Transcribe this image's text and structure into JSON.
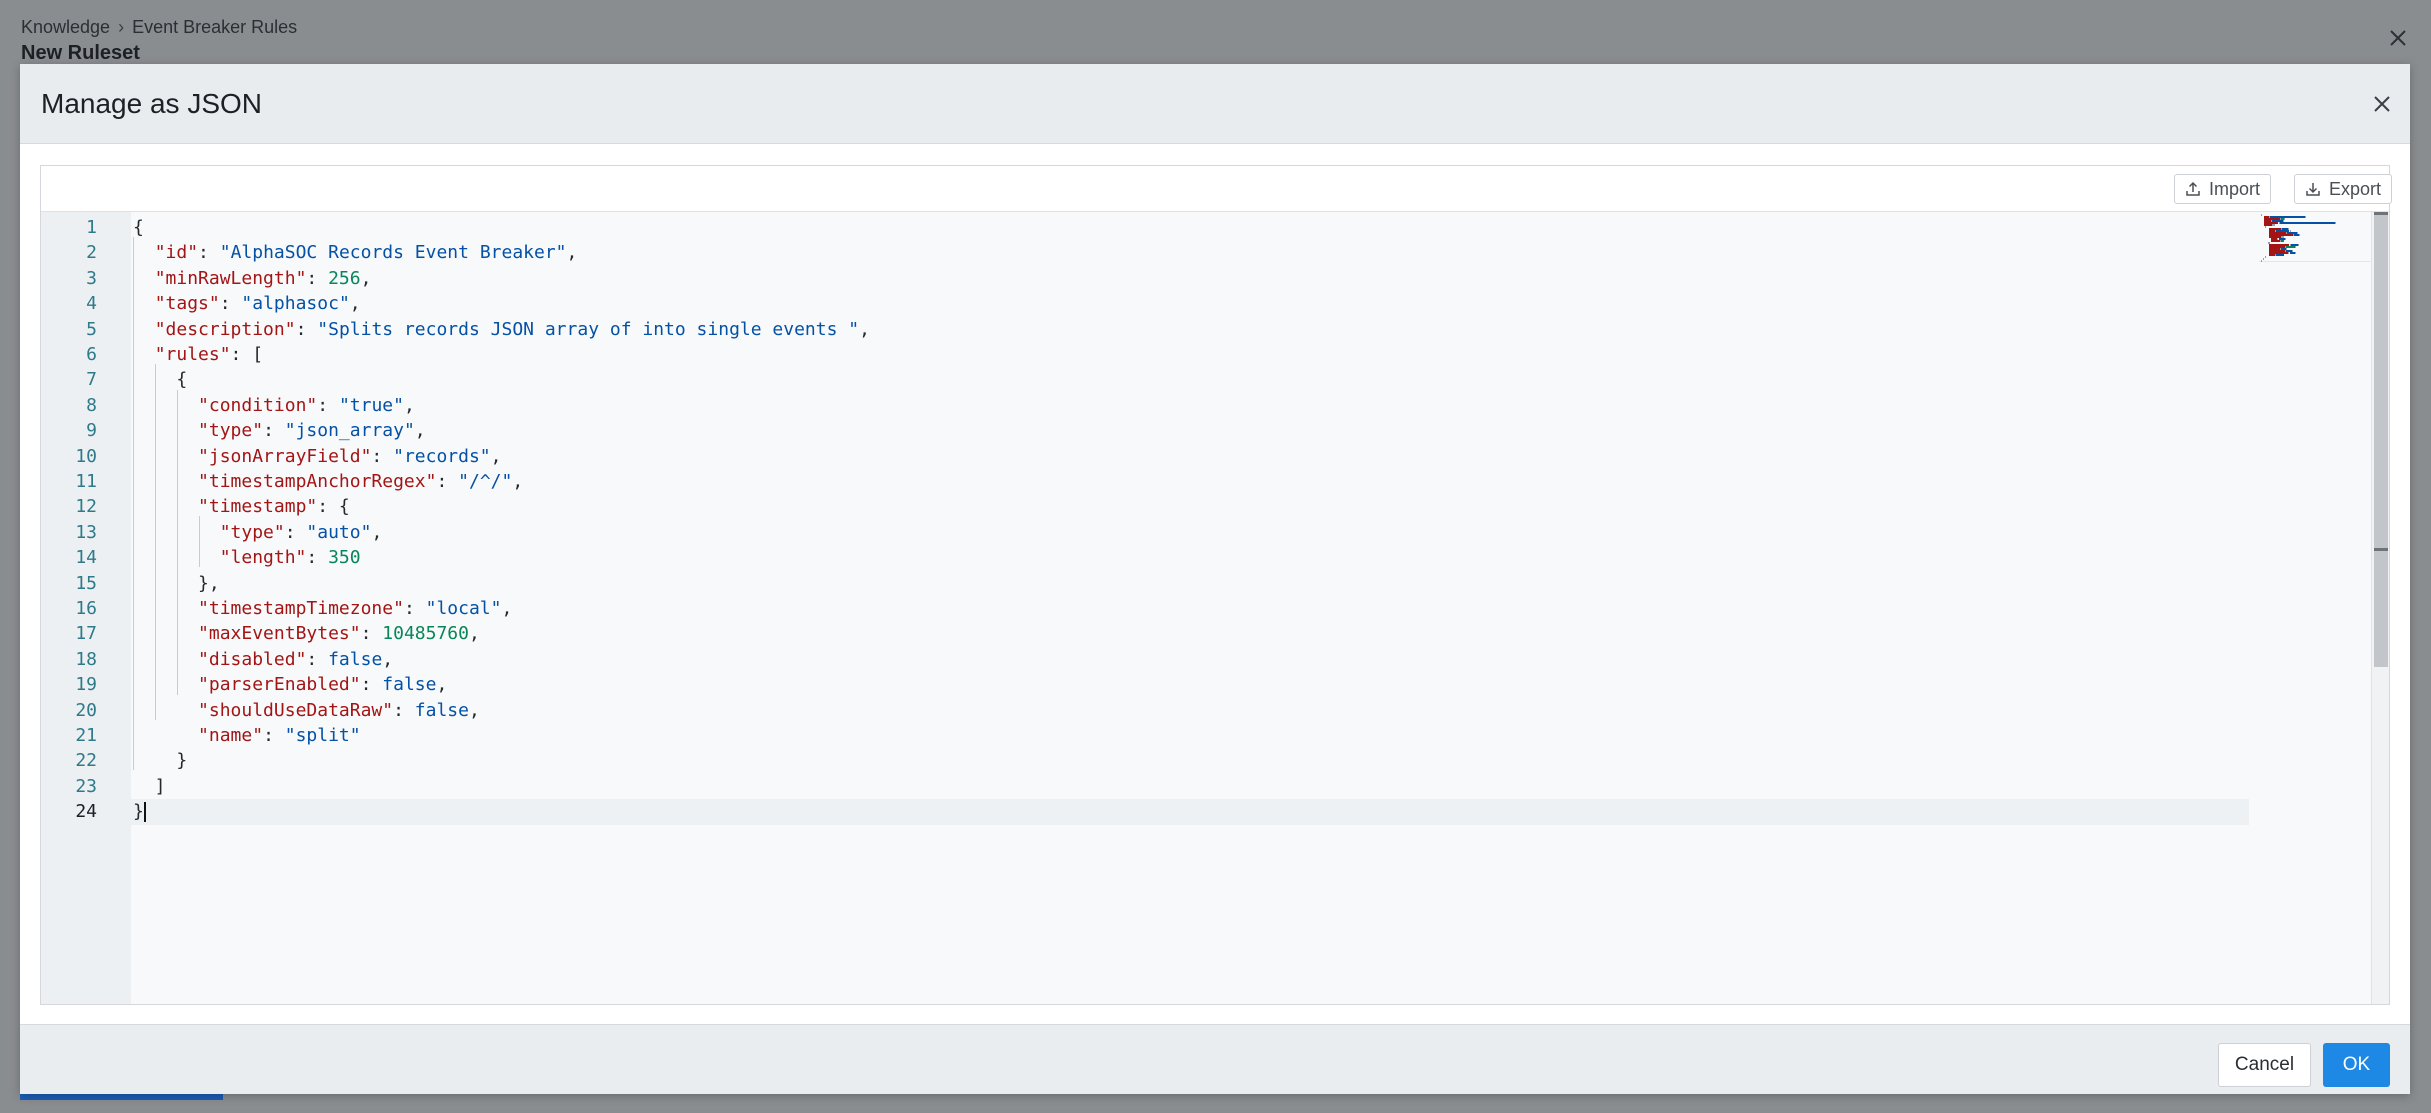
{
  "background": {
    "breadcrumb": [
      "Knowledge",
      "Event Breaker Rules"
    ],
    "breadcrumb_separator": "›",
    "title": "New Ruleset"
  },
  "modal": {
    "title": "Manage as JSON",
    "toolbar": {
      "import_label": "Import",
      "export_label": "Export"
    },
    "footer": {
      "cancel_label": "Cancel",
      "ok_label": "OK"
    }
  },
  "editor": {
    "active_line": 24,
    "lines": [
      [
        [
          "p",
          "{"
        ]
      ],
      [
        [
          "p",
          "  "
        ],
        [
          "k",
          "\"id\""
        ],
        [
          "p",
          ": "
        ],
        [
          "s",
          "\"AlphaSOC Records Event Breaker\""
        ],
        [
          "p",
          ","
        ]
      ],
      [
        [
          "p",
          "  "
        ],
        [
          "k",
          "\"minRawLength\""
        ],
        [
          "p",
          ": "
        ],
        [
          "n",
          "256"
        ],
        [
          "p",
          ","
        ]
      ],
      [
        [
          "p",
          "  "
        ],
        [
          "k",
          "\"tags\""
        ],
        [
          "p",
          ": "
        ],
        [
          "s",
          "\"alphasoc\""
        ],
        [
          "p",
          ","
        ]
      ],
      [
        [
          "p",
          "  "
        ],
        [
          "k",
          "\"description\""
        ],
        [
          "p",
          ": "
        ],
        [
          "s",
          "\"Splits records JSON array of into single events \""
        ],
        [
          "p",
          ","
        ]
      ],
      [
        [
          "p",
          "  "
        ],
        [
          "k",
          "\"rules\""
        ],
        [
          "p",
          ": ["
        ]
      ],
      [
        [
          "p",
          "    {"
        ]
      ],
      [
        [
          "p",
          "      "
        ],
        [
          "k",
          "\"condition\""
        ],
        [
          "p",
          ": "
        ],
        [
          "s",
          "\"true\""
        ],
        [
          "p",
          ","
        ]
      ],
      [
        [
          "p",
          "      "
        ],
        [
          "k",
          "\"type\""
        ],
        [
          "p",
          ": "
        ],
        [
          "s",
          "\"json_array\""
        ],
        [
          "p",
          ","
        ]
      ],
      [
        [
          "p",
          "      "
        ],
        [
          "k",
          "\"jsonArrayField\""
        ],
        [
          "p",
          ": "
        ],
        [
          "s",
          "\"records\""
        ],
        [
          "p",
          ","
        ]
      ],
      [
        [
          "p",
          "      "
        ],
        [
          "k",
          "\"timestampAnchorRegex\""
        ],
        [
          "p",
          ": "
        ],
        [
          "s",
          "\"/^/\""
        ],
        [
          "p",
          ","
        ]
      ],
      [
        [
          "p",
          "      "
        ],
        [
          "k",
          "\"timestamp\""
        ],
        [
          "p",
          ": {"
        ]
      ],
      [
        [
          "p",
          "        "
        ],
        [
          "k",
          "\"type\""
        ],
        [
          "p",
          ": "
        ],
        [
          "s",
          "\"auto\""
        ],
        [
          "p",
          ","
        ]
      ],
      [
        [
          "p",
          "        "
        ],
        [
          "k",
          "\"length\""
        ],
        [
          "p",
          ": "
        ],
        [
          "n",
          "350"
        ]
      ],
      [
        [
          "p",
          "      },"
        ]
      ],
      [
        [
          "p",
          "      "
        ],
        [
          "k",
          "\"timestampTimezone\""
        ],
        [
          "p",
          ": "
        ],
        [
          "s",
          "\"local\""
        ],
        [
          "p",
          ","
        ]
      ],
      [
        [
          "p",
          "      "
        ],
        [
          "k",
          "\"maxEventBytes\""
        ],
        [
          "p",
          ": "
        ],
        [
          "n",
          "10485760"
        ],
        [
          "p",
          ","
        ]
      ],
      [
        [
          "p",
          "      "
        ],
        [
          "k",
          "\"disabled\""
        ],
        [
          "p",
          ": "
        ],
        [
          "b",
          "false"
        ],
        [
          "p",
          ","
        ]
      ],
      [
        [
          "p",
          "      "
        ],
        [
          "k",
          "\"parserEnabled\""
        ],
        [
          "p",
          ": "
        ],
        [
          "b",
          "false"
        ],
        [
          "p",
          ","
        ]
      ],
      [
        [
          "p",
          "      "
        ],
        [
          "k",
          "\"shouldUseDataRaw\""
        ],
        [
          "p",
          ": "
        ],
        [
          "b",
          "false"
        ],
        [
          "p",
          ","
        ]
      ],
      [
        [
          "p",
          "      "
        ],
        [
          "k",
          "\"name\""
        ],
        [
          "p",
          ": "
        ],
        [
          "s",
          "\"split\""
        ]
      ],
      [
        [
          "p",
          "    }"
        ]
      ],
      [
        [
          "p",
          "  ]"
        ]
      ],
      [
        [
          "p",
          "}"
        ]
      ]
    ]
  },
  "colors": {
    "key": "#a31515",
    "string": "#0451a5",
    "number": "#098658",
    "boolean": "#0451a5",
    "ok_button": "#1e88e5"
  }
}
